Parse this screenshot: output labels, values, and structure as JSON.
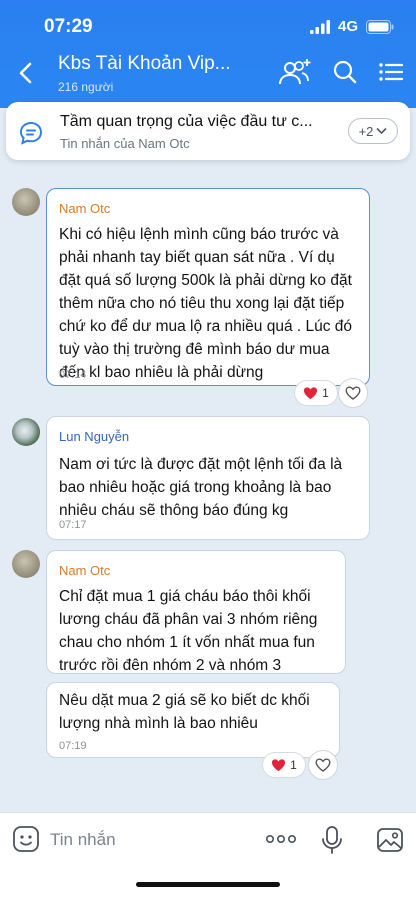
{
  "status": {
    "time": "07:29",
    "network": "4G"
  },
  "header": {
    "title": "Kbs Tài Khoản Vip...",
    "members": "216 người"
  },
  "pinned": {
    "title": "Tầm quan trọng của việc đầu tư c...",
    "subtitle": "Tin nhắn của Nam Otc",
    "more_label": "+2"
  },
  "messages": [
    {
      "sender": "Nam Otc",
      "text": "Khi có hiệu lệnh mình cũng báo trước và phải nhanh tay biết quan sát nữa . Ví dụ đặt quá số lượng 500k là phải dừng ko đặt thêm nữa cho nó tiêu thu xong lại đặt tiếp chứ ko để dư mua lộ ra nhiều quá . Lúc đó tuỳ vào thị trường đê mình báo dư mua đến kl bao nhiêu là phải dừng",
      "time": "07:14",
      "reaction_count": "1"
    },
    {
      "sender": "Lun Nguyễn",
      "text": "Nam ơi tức là được đặt một lệnh tối đa là bao nhiêu hoặc giá trong khoảng là bao nhiêu cháu sẽ thông báo đúng kg",
      "time": "07:17"
    },
    {
      "sender": "Nam Otc",
      "text": "Chỉ đặt mua 1 giá cháu báo thôi khối lương cháu đã phân vai 3 nhóm riêng chau cho nhóm 1 ít vốn nhất mua fun trước rồi đên nhóm 2 và nhóm 3"
    },
    {
      "text": "Nêu dặt mua 2 giá sẽ ko biết dc khối lượng nhà mình là bao nhiêu",
      "time": "07:19",
      "reaction_count": "1"
    }
  ],
  "composer": {
    "placeholder": "Tin nhắn"
  }
}
